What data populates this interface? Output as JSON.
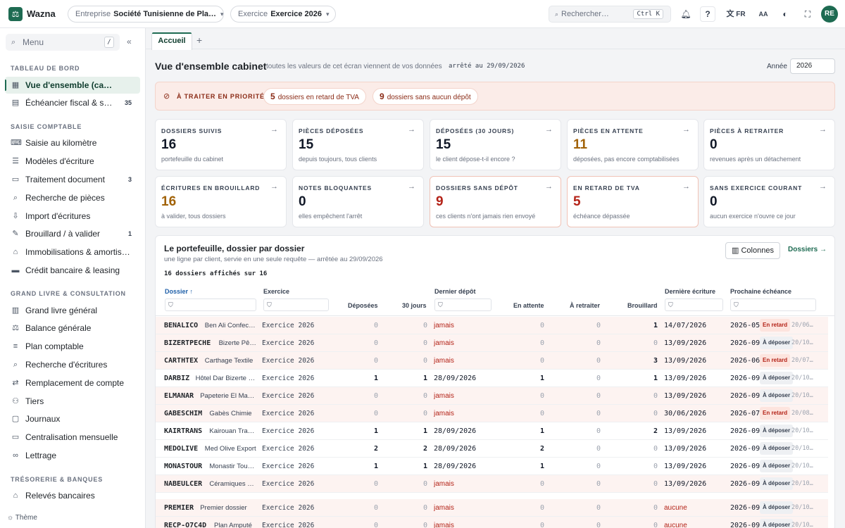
{
  "app": {
    "logo": "⚖",
    "name": "Wazna"
  },
  "topbar": {
    "entreprise_label": "Entreprise",
    "entreprise_value": "Société Tunisienne de Pla…",
    "exercice_label": "Exercice",
    "exercice_value": "Exercice 2026",
    "search_placeholder": "Rechercher…",
    "search_shortcut": "Ctrl K",
    "help": "?",
    "lang": "FR",
    "font_size": "AA",
    "user_initials": "RE"
  },
  "sidebar": {
    "menu_label": "Menu",
    "menu_shortcut": "/",
    "sections": [
      {
        "title": "TABLEAU DE BORD",
        "items": [
          {
            "label": "Vue d'ensemble (cabinet)",
            "icon": "grid-icon",
            "active": true
          },
          {
            "label": "Échéancier fiscal & sociales",
            "icon": "calendar-icon",
            "count": "35"
          }
        ]
      },
      {
        "title": "SAISIE COMPTABLE",
        "items": [
          {
            "label": "Saisie au kilomètre",
            "icon": "keyboard-icon"
          },
          {
            "label": "Modèles d'écriture",
            "icon": "template-icon"
          },
          {
            "label": "Traitement document",
            "icon": "document-icon",
            "count": "3"
          },
          {
            "label": "Recherche de pièces",
            "icon": "search-icon"
          },
          {
            "label": "Import d'écritures",
            "icon": "import-icon"
          },
          {
            "label": "Brouillard / à valider",
            "icon": "draft-icon",
            "count": "1"
          },
          {
            "label": "Immobilisations & amortissements",
            "icon": "building-icon"
          },
          {
            "label": "Crédit bancaire & leasing",
            "icon": "card-icon"
          }
        ]
      },
      {
        "title": "GRAND LIVRE & CONSULTATION",
        "items": [
          {
            "label": "Grand livre général",
            "icon": "book-icon"
          },
          {
            "label": "Balance générale",
            "icon": "scale-icon"
          },
          {
            "label": "Plan comptable",
            "icon": "list-icon"
          },
          {
            "label": "Recherche d'écritures",
            "icon": "search-icon"
          },
          {
            "label": "Remplacement de compte",
            "icon": "swap-icon"
          },
          {
            "label": "Tiers",
            "icon": "users-icon"
          },
          {
            "label": "Journaux",
            "icon": "journal-icon"
          },
          {
            "label": "Centralisation mensuelle",
            "icon": "document-icon"
          },
          {
            "label": "Lettrage",
            "icon": "link-icon"
          }
        ]
      },
      {
        "title": "TRÉSORERIE & BANQUES",
        "items": [
          {
            "label": "Relevés bancaires",
            "icon": "bank-icon"
          }
        ]
      }
    ],
    "theme_label": "Thème"
  },
  "tabs": {
    "active": "Accueil",
    "add": "+"
  },
  "header": {
    "title": "Vue d'ensemble cabinet",
    "subtitle": "toutes les valeurs de cet écran viennent de vos données",
    "date": "arrêté au 29/09/2026",
    "year_label": "Année",
    "year_value": "2026"
  },
  "priority": {
    "label": "À TRAITER EN PRIORITÉ",
    "chips": [
      {
        "count": "5",
        "text": "dossiers en retard de TVA"
      },
      {
        "count": "9",
        "text": "dossiers sans aucun dépôt"
      }
    ]
  },
  "cards": [
    {
      "title": "DOSSIERS SUIVIS",
      "value": "16",
      "sub": "portefeuille du cabinet",
      "color": "#111827",
      "warn": false
    },
    {
      "title": "PIÈCES DÉPOSÉES",
      "value": "15",
      "sub": "depuis toujours, tous clients",
      "color": "#111827",
      "warn": false
    },
    {
      "title": "DÉPOSÉES (30 JOURS)",
      "value": "15",
      "sub": "le client dépose-t-il encore ?",
      "color": "#111827",
      "warn": false
    },
    {
      "title": "PIÈCES EN ATTENTE",
      "value": "11",
      "sub": "déposées, pas encore comptabilisées",
      "color": "#a16207",
      "warn": false
    },
    {
      "title": "PIÈCES À RETRAITER",
      "value": "0",
      "sub": "revenues après un détachement",
      "color": "#111827",
      "warn": false
    },
    {
      "title": "ÉCRITURES EN BROUILLARD",
      "value": "16",
      "sub": "à valider, tous dossiers",
      "color": "#a16207",
      "warn": false
    },
    {
      "title": "NOTES BLOQUANTES",
      "value": "0",
      "sub": "elles empêchent l'arrêt",
      "color": "#111827",
      "warn": false
    },
    {
      "title": "DOSSIERS SANS DÉPÔT",
      "value": "9",
      "sub": "ces clients n'ont jamais rien envoyé",
      "color": "#b42318",
      "warn": true
    },
    {
      "title": "EN RETARD DE TVA",
      "value": "5",
      "sub": "échéance dépassée",
      "color": "#b42318",
      "warn": true
    },
    {
      "title": "SANS EXERCICE COURANT",
      "value": "0",
      "sub": "aucun exercice n'ouvre ce jour",
      "color": "#111827",
      "warn": false
    }
  ],
  "portfolio": {
    "title": "Le portefeuille, dossier par dossier",
    "subtitle": "une ligne par client, servie en une seule requête — arrêtée au 29/09/2026",
    "count": "16 dossiers affichés sur 16",
    "columns_btn": "Colonnes",
    "dossiers_link": "Dossiers →",
    "headers": {
      "dossier": "Dossier ↑",
      "exercice": "Exercice",
      "deposees": "Déposées",
      "jours30": "30 jours",
      "dernier_depot": "Dernier dépôt",
      "en_attente": "En attente",
      "a_retraiter": "À retraiter",
      "brouillard": "Brouillard",
      "derniere_ecriture": "Dernière écriture",
      "prochaine": "Prochaine échéance"
    },
    "rows": [
      {
        "code": "BENALICO",
        "name": "Ben Ali Confection",
        "ex": "Exercice 2026",
        "dep": "0",
        "j30": "0",
        "last": "jamais",
        "att": "0",
        "ret": "0",
        "br": "1",
        "ecr": "14/07/2026",
        "per": "2026-05",
        "status": "En retard",
        "late": true,
        "due": "20/06…"
      },
      {
        "code": "BIZERTPECHE",
        "name": "Bizerte Pêche",
        "ex": "Exercice 2026",
        "dep": "0",
        "j30": "0",
        "last": "jamais",
        "att": "0",
        "ret": "0",
        "br": "0",
        "ecr": "13/09/2026",
        "per": "2026-09",
        "status": "À déposer",
        "late": false,
        "due": "20/10…"
      },
      {
        "code": "CARTHTEX",
        "name": "Carthage Textile",
        "ex": "Exercice 2026",
        "dep": "0",
        "j30": "0",
        "last": "jamais",
        "att": "0",
        "ret": "0",
        "br": "3",
        "ecr": "13/09/2026",
        "per": "2026-06",
        "status": "En retard",
        "late": true,
        "due": "20/07…"
      },
      {
        "code": "DARBIZ",
        "name": "Hôtel Dar Bizerte Sa",
        "ex": "Exercice 2026",
        "dep": "1",
        "j30": "1",
        "last": "28/09/2026",
        "att": "1",
        "ret": "0",
        "br": "1",
        "ecr": "13/09/2026",
        "per": "2026-09",
        "status": "À déposer",
        "late": false,
        "due": "20/10…"
      },
      {
        "code": "ELMANAR",
        "name": "Papeterie El Manar",
        "ex": "Exercice 2026",
        "dep": "0",
        "j30": "0",
        "last": "jamais",
        "att": "0",
        "ret": "0",
        "br": "0",
        "ecr": "13/09/2026",
        "per": "2026-09",
        "status": "À déposer",
        "late": false,
        "due": "20/10…"
      },
      {
        "code": "GABESCHIM",
        "name": "Gabès Chimie",
        "ex": "Exercice 2026",
        "dep": "0",
        "j30": "0",
        "last": "jamais",
        "att": "0",
        "ret": "0",
        "br": "0",
        "ecr": "30/06/2026",
        "per": "2026-07",
        "status": "En retard",
        "late": true,
        "due": "20/08…"
      },
      {
        "code": "KAIRTRANS",
        "name": "Kairouan Transport",
        "ex": "Exercice 2026",
        "dep": "1",
        "j30": "1",
        "last": "28/09/2026",
        "att": "1",
        "ret": "0",
        "br": "2",
        "ecr": "13/09/2026",
        "per": "2026-09",
        "status": "À déposer",
        "late": false,
        "due": "20/10…"
      },
      {
        "code": "MEDOLIVE",
        "name": "Med Olive Export",
        "ex": "Exercice 2026",
        "dep": "2",
        "j30": "2",
        "last": "28/09/2026",
        "att": "2",
        "ret": "0",
        "br": "0",
        "ecr": "13/09/2026",
        "per": "2026-09",
        "status": "À déposer",
        "late": false,
        "due": "20/10…"
      },
      {
        "code": "MONASTOUR",
        "name": "Monastir Tourisme",
        "ex": "Exercice 2026",
        "dep": "1",
        "j30": "1",
        "last": "28/09/2026",
        "att": "1",
        "ret": "0",
        "br": "0",
        "ecr": "13/09/2026",
        "per": "2026-09",
        "status": "À déposer",
        "late": false,
        "due": "20/10…"
      },
      {
        "code": "NABEULCER",
        "name": "Céramiques de Nabeul",
        "ex": "Exercice 2026",
        "dep": "0",
        "j30": "0",
        "last": "jamais",
        "att": "0",
        "ret": "0",
        "br": "0",
        "ecr": "13/09/2026",
        "per": "2026-09",
        "status": "À déposer",
        "late": false,
        "due": "20/10…"
      },
      {
        "code": "PREMIER",
        "name": "Premier dossier",
        "ex": "Exercice 2026",
        "dep": "0",
        "j30": "0",
        "last": "jamais",
        "att": "0",
        "ret": "0",
        "br": "0",
        "ecr": "aucune",
        "per": "2026-09",
        "status": "À déposer",
        "late": false,
        "due": "20/10…"
      },
      {
        "code": "RECP-O7C4D",
        "name": "Plan Amputé",
        "ex": "Exercice 2026",
        "dep": "0",
        "j30": "0",
        "last": "jamais",
        "att": "0",
        "ret": "0",
        "br": "0",
        "ecr": "aucune",
        "per": "2026-09",
        "status": "À déposer",
        "late": false,
        "due": "20/10…"
      }
    ]
  }
}
